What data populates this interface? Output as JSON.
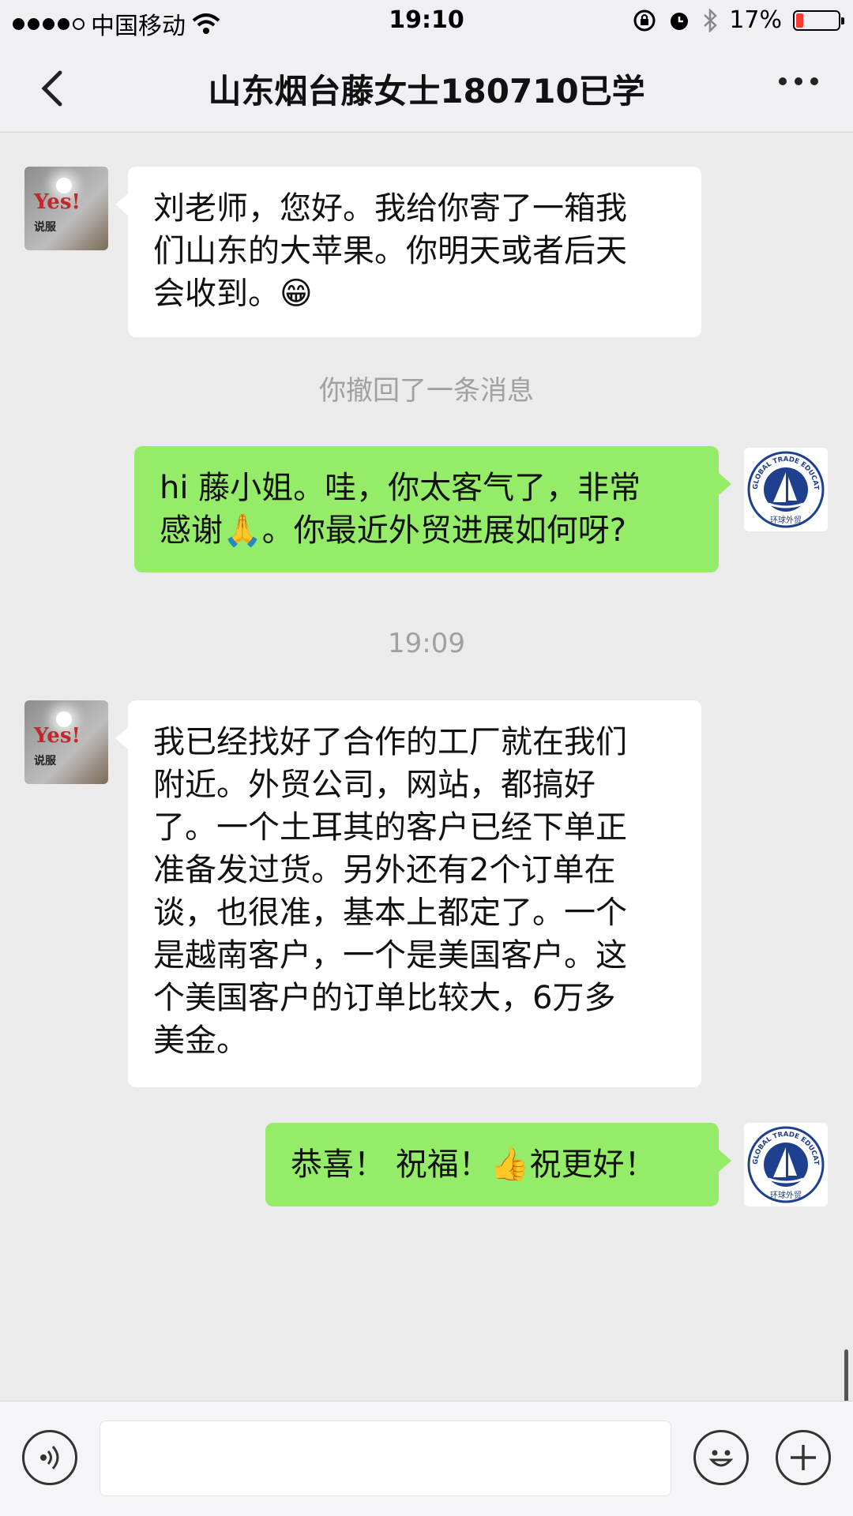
{
  "status_bar": {
    "carrier": "中国移动",
    "time": "19:10",
    "battery_percent": "17%",
    "battery_level": 0.17,
    "battery_color": "#ff3b30"
  },
  "nav": {
    "title": "山东烟台藤女士180710已学",
    "back_icon": "chevron-left-icon",
    "more_icon": "more-icon"
  },
  "messages": [
    {
      "direction": "incoming",
      "avatar": "yes-avatar",
      "avatar_text": "Yes!",
      "avatar_sub": "说服",
      "lines": [
        "刘老师，您好。我给你寄了一箱我",
        "们山东的大苹果。你明天或者后天",
        "会收到。😁"
      ]
    },
    {
      "system": "你撤回了一条消息"
    },
    {
      "direction": "outgoing",
      "avatar": "global-trade-education-logo",
      "lines": [
        "hi 藤小姐。哇，你太客气了，非常",
        "感谢🙏。你最近外贸进展如何呀?"
      ]
    },
    {
      "timestamp": "19:09"
    },
    {
      "direction": "incoming",
      "avatar": "yes-avatar",
      "lines": [
        "我已经找好了合作的工厂就在我们",
        "附近。外贸公司，网站，都搞好",
        "了。一个土耳其的客户已经下单正",
        "准备发过货。另外还有2个订单在",
        "谈，也很准，基本上都定了。一个",
        "是越南客户，一个是美国客户。这",
        "个美国客户的订单比较大，6万多",
        "美金。"
      ]
    },
    {
      "direction": "outgoing",
      "avatar": "global-trade-education-logo",
      "lines": [
        "恭喜！ 祝福！👍祝更好！"
      ]
    }
  ],
  "logo": {
    "text_top": "GLOBAL TRADE EDUCATION",
    "text_bottom": "环球外贸"
  },
  "input_bar": {
    "voice_icon": "voice-icon",
    "emoji_icon": "emoji-icon",
    "plus_icon": "plus-icon",
    "input_value": ""
  },
  "colors": {
    "outgoing_bubble": "#95ec69",
    "incoming_bubble": "#ffffff",
    "chat_background": "#ebebeb"
  }
}
